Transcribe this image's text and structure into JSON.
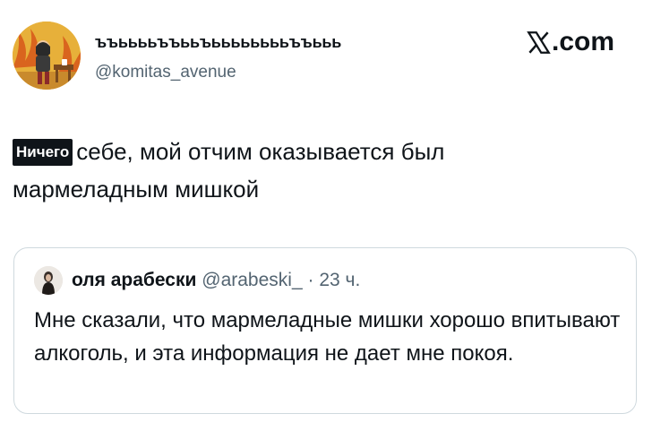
{
  "author": {
    "name": "ъъььььъъььъььььььььъъььь",
    "handle": "@komitas_avenue"
  },
  "brand": {
    "label": ".com"
  },
  "tweet": {
    "highlight": "Ничего",
    "text": "себе, мой отчим оказывается был мармеладным мишкой"
  },
  "quoted": {
    "name": "оля арабески",
    "handle": "@arabeski_",
    "separator": "·",
    "time": "23 ч.",
    "text": "Мне сказали, что мармеладные мишки хорошо впитывают алкоголь, и эта информация не дает мне покоя."
  },
  "colors": {
    "text": "#0f1419",
    "secondary": "#536471",
    "border": "#cfd9de",
    "highlight_bg": "#0f1419"
  }
}
